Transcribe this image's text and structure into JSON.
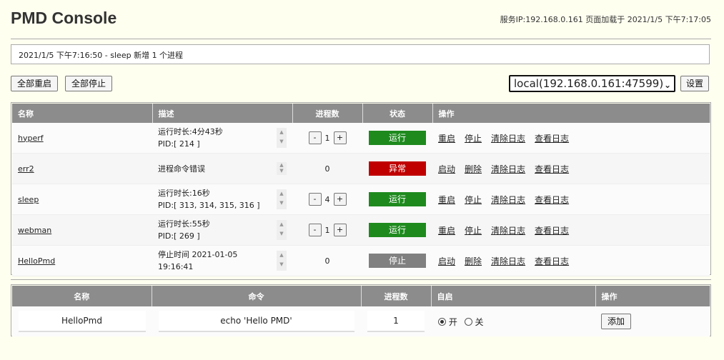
{
  "header": {
    "title": "PMD Console",
    "server_info": "服务IP:192.168.0.161 页面加载于 2021/1/5 下午7:17:05"
  },
  "message": "2021/1/5 下午7:16:50 - sleep 新增 1 个进程",
  "toolbar": {
    "restart_all": "全部重启",
    "stop_all": "全部停止",
    "server_select": "local(192.168.0.161:47599)",
    "settings": "设置"
  },
  "process_table": {
    "headers": {
      "name": "名称",
      "desc": "描述",
      "count": "进程数",
      "status": "状态",
      "actions": "操作"
    },
    "rows": [
      {
        "name": "hyperf",
        "desc_line1": "运行时长:4分43秒",
        "desc_line2": "PID:[ 214 ]",
        "count": "1",
        "status": "运行",
        "status_color": "#1e8a1e",
        "action1": "重启",
        "action2": "停止",
        "action3": "清除日志",
        "action4": "查看日志"
      },
      {
        "name": "err2",
        "desc_line1": "进程命令错误",
        "desc_line2": "",
        "count": "0",
        "status": "异常",
        "status_color": "#c00000",
        "action1": "启动",
        "action2": "删除",
        "action3": "清除日志",
        "action4": "查看日志"
      },
      {
        "name": "sleep",
        "desc_line1": "运行时长:16秒",
        "desc_line2": "PID:[ 313, 314, 315, 316 ]",
        "count": "4",
        "status": "运行",
        "status_color": "#1e8a1e",
        "action1": "重启",
        "action2": "停止",
        "action3": "清除日志",
        "action4": "查看日志"
      },
      {
        "name": "webman",
        "desc_line1": "运行时长:55秒",
        "desc_line2": "PID:[ 269 ]",
        "count": "1",
        "status": "运行",
        "status_color": "#1e8a1e",
        "action1": "重启",
        "action2": "停止",
        "action3": "清除日志",
        "action4": "查看日志"
      },
      {
        "name": "HelloPmd",
        "desc_line1": "停止时间 2021-01-05",
        "desc_line2": "19:16:41",
        "count": "0",
        "status": "停止",
        "status_color": "#808080",
        "action1": "启动",
        "action2": "删除",
        "action3": "清除日志",
        "action4": "查看日志"
      }
    ]
  },
  "add_table": {
    "headers": {
      "name": "名称",
      "command": "命令",
      "count": "进程数",
      "autostart": "自启",
      "actions": "操作"
    },
    "name_value": "HelloPmd",
    "command_value": "echo 'Hello PMD'",
    "count_value": "1",
    "autostart_on": "开",
    "autostart_off": "关",
    "add_button": "添加"
  }
}
